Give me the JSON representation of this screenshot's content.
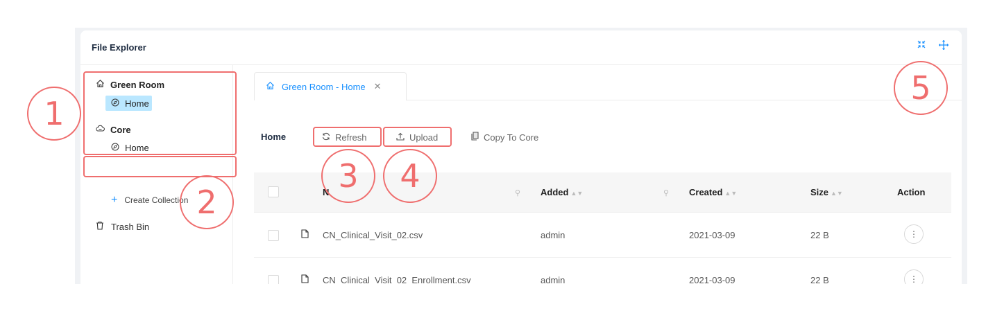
{
  "header": {
    "title": "File Explorer",
    "icons": [
      "collapse-icon",
      "drag-icon"
    ]
  },
  "sidebar": {
    "groups": [
      {
        "label": "Green Room",
        "icon": "home-icon",
        "children": [
          {
            "label": "Home",
            "icon": "compass-icon",
            "selected": true
          }
        ]
      },
      {
        "label": "Core",
        "icon": "cloud-icon",
        "children": [
          {
            "label": "Home",
            "icon": "compass-icon",
            "selected": false
          }
        ]
      }
    ],
    "create_collection": "Create Collection",
    "trash_bin": "Trash Bin"
  },
  "tabs": [
    {
      "label": "Green Room - Home",
      "icon": "home-icon",
      "closable": true
    }
  ],
  "toolbar": {
    "title": "Home",
    "refresh": "Refresh",
    "upload": "Upload",
    "copy_to_core": "Copy To Core"
  },
  "table": {
    "columns": {
      "name": "N",
      "added": "Added",
      "created": "Created",
      "size": "Size",
      "action": "Action"
    },
    "rows": [
      {
        "name": "CN_Clinical_Visit_02.csv",
        "added": "admin",
        "created": "2021-03-09",
        "size": "22 B",
        "action": "⋮"
      },
      {
        "name": "CN_Clinical_Visit_02_Enrollment.csv",
        "added": "admin",
        "created": "2021-03-09",
        "size": "22 B",
        "action": "⋮"
      }
    ]
  },
  "annotations": {
    "a1": "1",
    "a2": "2",
    "a3": "3",
    "a4": "4",
    "a5": "5"
  },
  "colors": {
    "accent": "#1890ff",
    "annotation": "#ef6e6e",
    "selected": "#bae7ff"
  }
}
